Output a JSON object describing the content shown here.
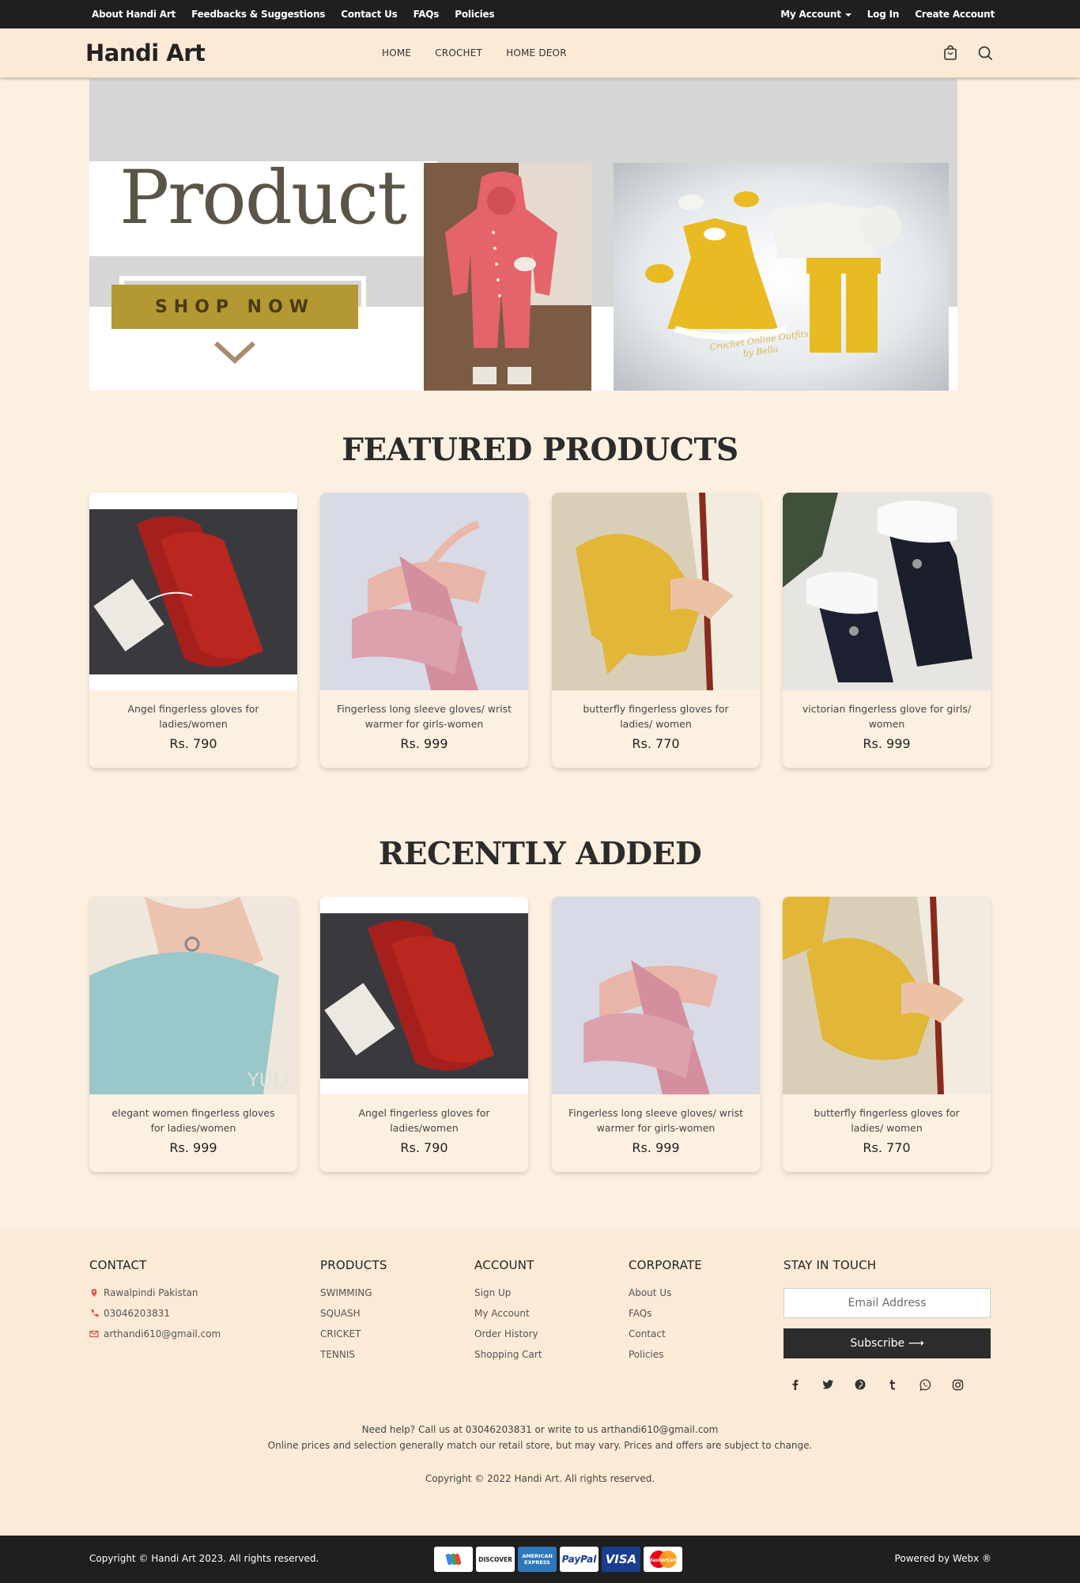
{
  "topbar": {
    "links": [
      "About Handi Art",
      "Feedbacks & Suggestions",
      "Contact Us",
      "FAQs",
      "Policies"
    ],
    "my_account": "My Account",
    "login": "Log In",
    "create_account": "Create Account"
  },
  "header": {
    "logo": "Handi Art",
    "nav": [
      "HOME",
      "CROCHET",
      "HOME DEOR"
    ],
    "cart_icon": "shopping-bag-icon",
    "search_icon": "search-icon"
  },
  "hero": {
    "title": "Product",
    "cta": "SHOP NOW",
    "image_caption_line1": "Crochet Online Outfits",
    "image_caption_line2": "by Bella"
  },
  "featured": {
    "title": "FEATURED PRODUCTS",
    "products": [
      {
        "name": "Angel fingerless gloves for ladies/women",
        "price": "Rs. 790"
      },
      {
        "name": "Fingerless long sleeve gloves/ wrist warmer for girls-women",
        "price": "Rs. 999"
      },
      {
        "name": "butterfly fingerless gloves for ladies/ women",
        "price": "Rs. 770"
      },
      {
        "name": "victorian fingerless glove for girls/ women",
        "price": "Rs. 999"
      }
    ]
  },
  "recent": {
    "title": "RECENTLY ADDED",
    "products": [
      {
        "name": "elegant women fingerless gloves for ladies/women",
        "price": "Rs. 999"
      },
      {
        "name": "Angel fingerless gloves for ladies/women",
        "price": "Rs. 790"
      },
      {
        "name": "Fingerless long sleeve gloves/ wrist warmer for girls-women",
        "price": "Rs. 999"
      },
      {
        "name": "butterfly fingerless gloves for ladies/ women",
        "price": "Rs. 770"
      }
    ]
  },
  "footer": {
    "contact": {
      "title": "CONTACT",
      "address": "Rawalpindi Pakistan",
      "phone": "03046203831",
      "email": "arthandi610@gmail.com"
    },
    "products": {
      "title": "PRODUCTS",
      "items": [
        "SWIMMING",
        "SQUASH",
        "CRICKET",
        "TENNIS"
      ]
    },
    "account": {
      "title": "ACCOUNT",
      "items": [
        "Sign Up",
        "My Account",
        "Order History",
        "Shopping Cart"
      ]
    },
    "corporate": {
      "title": "CORPORATE",
      "items": [
        "About Us",
        "FAQs",
        "Contact",
        "Policies"
      ]
    },
    "stay": {
      "title": "STAY IN TOUCH",
      "email_placeholder": "Email Address",
      "subscribe": "Subscribe ⟶",
      "socials": [
        "facebook-icon",
        "twitter-icon",
        "pinterest-icon",
        "tumblr-icon",
        "whatsapp-icon",
        "instagram-icon"
      ]
    },
    "help": "Need help? Call us at 03046203831 or write to us arthandi610@gmail.com",
    "disclaimer": "Online prices and selection generally match our retail store, but may vary. Prices and offers are subject to change.",
    "copyright": "Copyright © 2022 Handi Art. All rights reserved."
  },
  "bottombar": {
    "copyright": "Copyright © Handi Art 2023. All rights reserved.",
    "payments": [
      "G Pay",
      "DISCOVER",
      "AMERICAN EXPRESS",
      "PayPal",
      "VISA",
      "MasterCard"
    ],
    "powered": "Powered by Webx ®"
  },
  "colors": {
    "background": "#fdf0e0",
    "bar": "#1f1f1f",
    "cta": "#b49833"
  }
}
